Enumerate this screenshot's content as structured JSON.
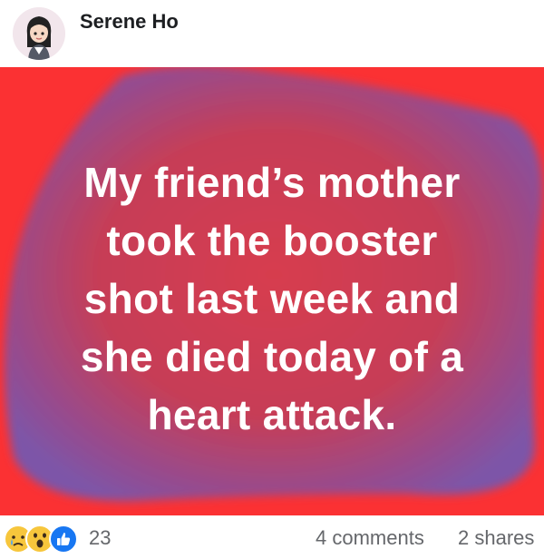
{
  "post": {
    "author": "Serene Ho",
    "text_lines": [
      "My friend’s mother",
      "took the booster",
      "shot last week and",
      "she died today of a",
      "heart attack."
    ],
    "background_colors": {
      "outer": "#fb3133",
      "blob": "#8b4a9c"
    }
  },
  "footer": {
    "reaction_icons": [
      "sad-icon",
      "wow-icon",
      "like-icon"
    ],
    "reaction_count": "23",
    "comments": "4 comments",
    "shares": "2 shares"
  }
}
